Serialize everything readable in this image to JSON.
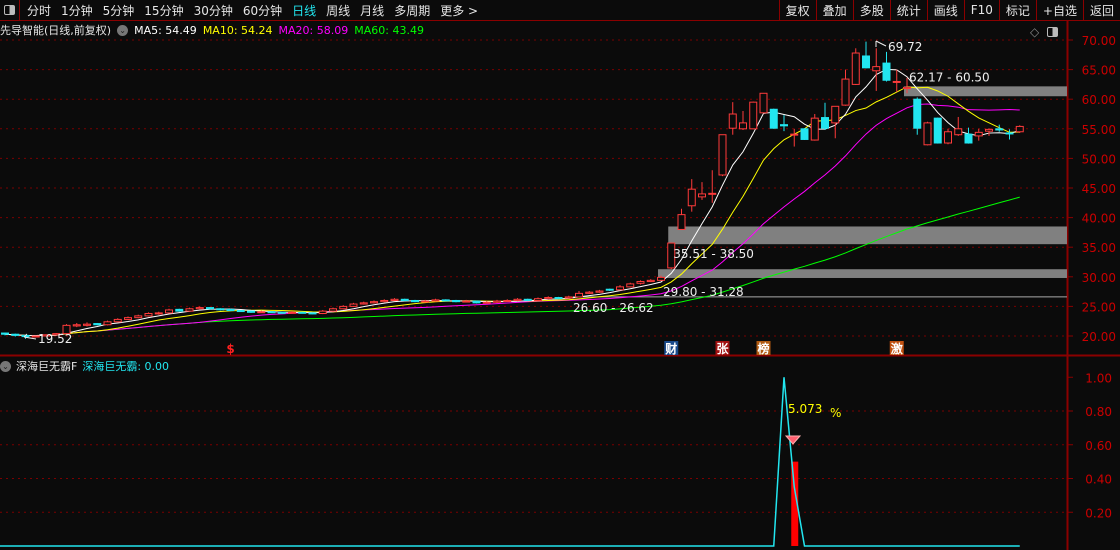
{
  "toolbar": {
    "tabs": [
      "分时",
      "1分钟",
      "5分钟",
      "15分钟",
      "30分钟",
      "60分钟",
      "日线",
      "周线",
      "月线",
      "多周期",
      "更多 >"
    ],
    "active": "日线",
    "right_buttons": [
      "复权",
      "叠加",
      "多股",
      "统计",
      "画线",
      "F10",
      "标记",
      "+自选",
      "返回"
    ]
  },
  "header": {
    "stock": "先导智能(日线,前复权)",
    "ma5": "MA5: 54.49",
    "ma10": "MA10: 54.24",
    "ma20": "MA20: 58.09",
    "ma60": "MA60: 43.49"
  },
  "colors": {
    "ma5": "#ffffff",
    "ma10": "#ffff00",
    "ma20": "#ff00ff",
    "ma60": "#00ff00",
    "up": "#ff3b3b",
    "down": "#22e6f0",
    "axis": "#cc0000",
    "indicator": "#22e6f0",
    "bar": "#ff0000"
  },
  "sub": {
    "name": "深海巨无霸F",
    "value": "深海巨无霸: 0.00"
  },
  "chart_data": [
    {
      "type": "candlestick",
      "title": "先导智能(日线,前复权)",
      "ylim": [
        17,
        72
      ],
      "yticks": [
        "70.00",
        "65.00",
        "60.00",
        "55.00",
        "50.00",
        "45.00",
        "40.00",
        "35.00",
        "30.00",
        "25.00",
        "20.00"
      ],
      "ohlc": [
        [
          20.5,
          20.6,
          20.1,
          20.3
        ],
        [
          20.3,
          20.4,
          19.9,
          20.1
        ],
        [
          20.1,
          20.2,
          19.52,
          19.9
        ],
        [
          19.9,
          20.1,
          19.8,
          20.0
        ],
        [
          20.0,
          20.3,
          19.9,
          20.2
        ],
        [
          20.2,
          20.5,
          20.1,
          20.4
        ],
        [
          20.4,
          22.0,
          20.3,
          21.8
        ],
        [
          21.7,
          22.2,
          21.5,
          21.9
        ],
        [
          21.8,
          22.3,
          21.6,
          22.0
        ],
        [
          22.1,
          22.2,
          21.8,
          21.9
        ],
        [
          21.9,
          22.6,
          21.8,
          22.4
        ],
        [
          22.4,
          23.0,
          22.3,
          22.8
        ],
        [
          22.8,
          23.3,
          22.7,
          23.1
        ],
        [
          23.1,
          23.6,
          23.0,
          23.4
        ],
        [
          23.4,
          24.0,
          23.3,
          23.8
        ],
        [
          23.8,
          24.1,
          23.6,
          23.9
        ],
        [
          23.9,
          24.6,
          23.8,
          24.4
        ],
        [
          24.5,
          24.6,
          24.1,
          24.2
        ],
        [
          24.2,
          24.8,
          24.1,
          24.6
        ],
        [
          24.6,
          25.0,
          24.5,
          24.8
        ],
        [
          24.8,
          24.9,
          24.5,
          24.6
        ],
        [
          24.6,
          24.7,
          24.3,
          24.5
        ],
        [
          24.5,
          24.6,
          24.2,
          24.3
        ],
        [
          24.3,
          24.4,
          24.1,
          24.2
        ],
        [
          24.2,
          24.3,
          23.9,
          24.0
        ],
        [
          24.0,
          24.3,
          23.9,
          24.1
        ],
        [
          24.1,
          24.2,
          23.9,
          24.0
        ],
        [
          24.0,
          24.1,
          23.8,
          23.9
        ],
        [
          23.9,
          24.2,
          23.8,
          24.0
        ],
        [
          24.0,
          24.1,
          23.8,
          23.9
        ],
        [
          23.9,
          24.0,
          23.7,
          23.8
        ],
        [
          23.8,
          24.4,
          23.7,
          24.2
        ],
        [
          24.2,
          24.8,
          24.1,
          24.6
        ],
        [
          24.6,
          25.2,
          24.5,
          25.0
        ],
        [
          25.0,
          25.6,
          24.9,
          25.4
        ],
        [
          25.4,
          25.8,
          25.3,
          25.6
        ],
        [
          25.6,
          26.0,
          25.5,
          25.8
        ],
        [
          25.8,
          26.2,
          25.7,
          26.0
        ],
        [
          26.0,
          26.4,
          25.9,
          26.2
        ],
        [
          26.2,
          26.3,
          25.9,
          26.0
        ],
        [
          26.0,
          26.1,
          25.7,
          25.8
        ],
        [
          25.8,
          26.1,
          25.7,
          25.9
        ],
        [
          25.9,
          26.3,
          25.8,
          26.1
        ],
        [
          26.1,
          26.2,
          25.9,
          26.0
        ],
        [
          26.0,
          26.1,
          25.7,
          25.8
        ],
        [
          25.8,
          26.1,
          25.7,
          25.9
        ],
        [
          25.9,
          26.0,
          25.5,
          25.6
        ],
        [
          25.6,
          25.9,
          25.5,
          25.7
        ],
        [
          25.7,
          26.1,
          25.6,
          25.9
        ],
        [
          25.9,
          26.2,
          25.8,
          26.0
        ],
        [
          26.0,
          26.4,
          25.9,
          26.2
        ],
        [
          26.2,
          26.3,
          25.9,
          26.0
        ],
        [
          26.0,
          26.5,
          25.9,
          26.3
        ],
        [
          26.3,
          26.7,
          26.2,
          26.5
        ],
        [
          26.5,
          26.6,
          26.2,
          26.4
        ],
        [
          26.4,
          26.8,
          26.3,
          26.6
        ],
        [
          26.6,
          27.6,
          26.5,
          27.2
        ],
        [
          27.2,
          27.6,
          27.1,
          27.4
        ],
        [
          27.4,
          27.8,
          27.3,
          27.6
        ],
        [
          27.9,
          28.0,
          27.6,
          27.8
        ],
        [
          27.8,
          28.6,
          27.7,
          28.3
        ],
        [
          28.3,
          29.0,
          28.2,
          28.8
        ],
        [
          28.9,
          29.4,
          28.7,
          29.2
        ],
        [
          29.2,
          29.6,
          29.1,
          29.4
        ],
        [
          29.4,
          30.2,
          29.3,
          29.9
        ],
        [
          31.5,
          35.7,
          31.3,
          35.7
        ],
        [
          38.0,
          41.5,
          37.9,
          40.5
        ],
        [
          42.0,
          46.5,
          41.0,
          44.8
        ],
        [
          43.5,
          46.0,
          43.0,
          44.0
        ],
        [
          44.0,
          48.0,
          42.5,
          44.1
        ],
        [
          47.2,
          54.0,
          47.0,
          54.0
        ],
        [
          55.1,
          59.5,
          54.0,
          57.5
        ],
        [
          55.0,
          58.0,
          54.8,
          56.0
        ],
        [
          55.0,
          59.6,
          54.9,
          59.5
        ],
        [
          57.7,
          61.0,
          57.6,
          61.0
        ],
        [
          58.3,
          58.4,
          55.0,
          55.1
        ],
        [
          55.7,
          57.3,
          54.6,
          55.5
        ],
        [
          54.0,
          55.0,
          52.0,
          54.1
        ],
        [
          55.0,
          55.1,
          53.1,
          53.2
        ],
        [
          53.1,
          57.5,
          53.0,
          56.8
        ],
        [
          56.9,
          59.4,
          54.8,
          55.1
        ],
        [
          56.0,
          58.8,
          53.4,
          58.8
        ],
        [
          59.0,
          65.0,
          58.9,
          63.4
        ],
        [
          62.5,
          68.6,
          62.4,
          67.8
        ],
        [
          67.3,
          69.72,
          65.2,
          65.3
        ],
        [
          64.8,
          68.6,
          61.4,
          65.5
        ],
        [
          66.1,
          68.0,
          63.0,
          63.2
        ],
        [
          63.0,
          65.0,
          61.2,
          63.0
        ],
        [
          61.8,
          63.6,
          61.0,
          62.0
        ],
        [
          60.0,
          60.3,
          54.0,
          55.1
        ],
        [
          52.3,
          56.2,
          52.2,
          56.0
        ],
        [
          56.8,
          56.9,
          52.5,
          52.6
        ],
        [
          52.6,
          55.0,
          52.4,
          54.5
        ],
        [
          54.0,
          57.0,
          53.8,
          55.0
        ],
        [
          54.1,
          55.2,
          52.5,
          52.6
        ],
        [
          53.8,
          55.0,
          53.0,
          54.4
        ],
        [
          54.6,
          55.1,
          53.8,
          54.9
        ],
        [
          55.0,
          55.7,
          54.5,
          54.8
        ],
        [
          54.3,
          54.9,
          53.2,
          54.2
        ],
        [
          54.5,
          55.6,
          54.3,
          55.4
        ]
      ],
      "zones": [
        {
          "label": "35.51 - 38.50",
          "low": 35.51,
          "high": 38.5,
          "start": 65
        },
        {
          "label": "29.80 - 31.28",
          "low": 29.8,
          "high": 31.28,
          "start": 64
        },
        {
          "label": "62.17 - 60.50",
          "low": 60.5,
          "high": 62.17,
          "start": 88
        }
      ],
      "level_line": {
        "label": "26.60 - 26.62",
        "value": 26.6,
        "start": 56
      },
      "annotations": {
        "high": "69.72",
        "low": "19.52"
      },
      "markers": [
        {
          "text": "$",
          "index": 22,
          "color": "#ff2020",
          "bg": ""
        },
        {
          "text": "财",
          "index": 65,
          "color": "#ffffff",
          "bg": "#1a4a8a"
        },
        {
          "text": "张",
          "index": 70,
          "color": "#ffffff",
          "bg": "#a01010"
        },
        {
          "text": "榜",
          "index": 74,
          "color": "#ffffff",
          "bg": "#b05a10"
        },
        {
          "text": "激",
          "index": 87,
          "color": "#ffffff",
          "bg": "#c05010"
        }
      ]
    },
    {
      "type": "line+bar",
      "title": "深海巨无霸F",
      "ylim": [
        0,
        1.05
      ],
      "yticks": [
        "1.00",
        "0.80",
        "0.60",
        "0.40",
        "0.20"
      ],
      "line": [
        {
          "index": 75,
          "value": 0
        },
        {
          "index": 76,
          "value": 1.0
        },
        {
          "index": 77,
          "value": 0.35
        },
        {
          "index": 78,
          "value": 0
        }
      ],
      "bar": {
        "index": 77,
        "value": 0.5
      },
      "label": "5.073",
      "label_unit": "%"
    }
  ]
}
